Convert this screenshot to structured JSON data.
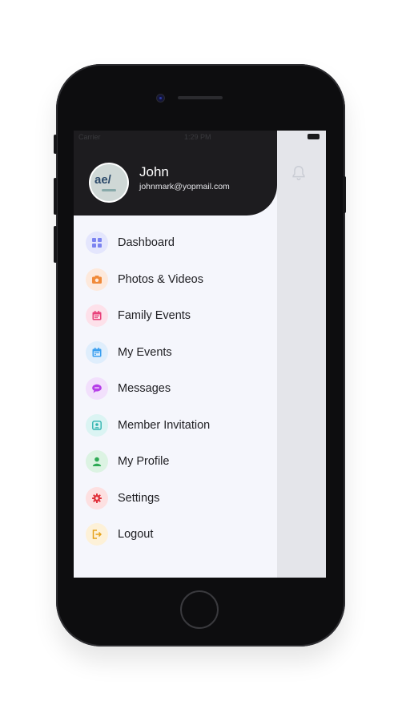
{
  "status": {
    "carrier": "Carrier",
    "time": "1:29 PM"
  },
  "profile": {
    "name": "John",
    "email": "johnmark@yopmail.com",
    "avatar_text": "ae/"
  },
  "menu": [
    {
      "label": "Dashboard",
      "icon": "dashboard-icon",
      "color": "#7b83f0",
      "bg": "#e4e6fd"
    },
    {
      "label": "Photos & Videos",
      "icon": "camera-icon",
      "color": "#f08a3a",
      "bg": "#fde9dc"
    },
    {
      "label": "Family Events",
      "icon": "calendar-icon",
      "color": "#e8407a",
      "bg": "#fde1ea"
    },
    {
      "label": "My Events",
      "icon": "calendar-icon",
      "color": "#3a9ff0",
      "bg": "#dfeefc"
    },
    {
      "label": "Messages",
      "icon": "chat-icon",
      "color": "#b640e8",
      "bg": "#f2e0fc"
    },
    {
      "label": "Member Invitation",
      "icon": "invitation-icon",
      "color": "#2fb3b0",
      "bg": "#dbf4f3"
    },
    {
      "label": "My Profile",
      "icon": "user-icon",
      "color": "#2eaa55",
      "bg": "#dcf3e3"
    },
    {
      "label": "Settings",
      "icon": "gear-icon",
      "color": "#e0303a",
      "bg": "#fde0e1"
    },
    {
      "label": "Logout",
      "icon": "logout-icon",
      "color": "#e6a21c",
      "bg": "#fdf1d8"
    }
  ]
}
